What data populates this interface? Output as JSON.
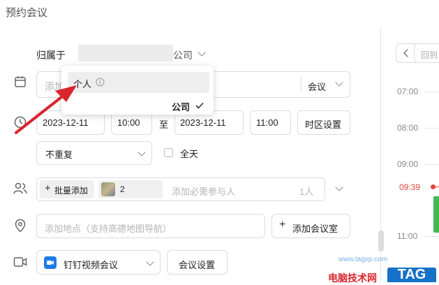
{
  "page": {
    "title": "预约会议"
  },
  "owner": {
    "label": "归属于",
    "org_suffix": "公司"
  },
  "subject": {
    "placeholder": "添加",
    "type_value": "会议"
  },
  "dropdown": {
    "personal_label": "个人",
    "company_label": "公司"
  },
  "time": {
    "start_date": "2023-12-11",
    "start_time": "10:00",
    "to_label": "至",
    "end_date": "2023-12-11",
    "end_time": "11:00",
    "timezone_button": "时区设置"
  },
  "repeat": {
    "value": "不重复",
    "allday_label": "全天"
  },
  "participants": {
    "bulk_add_label": "批量添加",
    "count_badge": "2",
    "placeholder": "添加必需参与人",
    "people_count": "1人"
  },
  "location": {
    "placeholder": "添加地点（支持高德地图导航）",
    "add_room_button": "添加会议室"
  },
  "video": {
    "provider": "钉钉视频会议",
    "settings_button": "会议设置"
  },
  "calendar": {
    "back_label": "回到",
    "hours": [
      "07:00",
      "08:00",
      "09:00",
      "11:00"
    ],
    "now_time": "09:39",
    "now_color": "#e0473b",
    "event_color": "#3fb950"
  },
  "watermark": {
    "site_text": "电脑技术网",
    "url_text": "www.tagxp.com",
    "logo_text": "TAG"
  },
  "colors": {
    "arrow": "#d8262d",
    "accent_blue": "#1e7be6"
  }
}
